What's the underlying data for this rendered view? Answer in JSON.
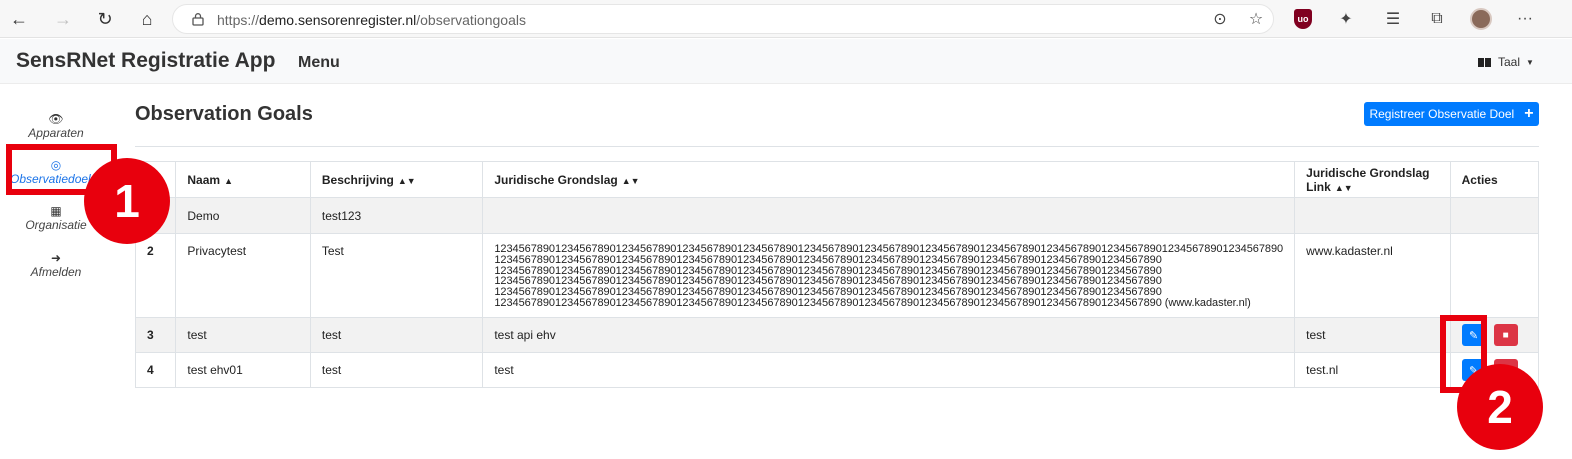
{
  "browser": {
    "url_prefix": "https://",
    "url_host": "demo.sensorenregister.nl",
    "url_path": "/observationgoals",
    "more": "···"
  },
  "navbar": {
    "brand": "SensRNet Registratie App",
    "menu": "Menu",
    "language": "Taal"
  },
  "sidebar": {
    "items": [
      {
        "label": "Apparaten",
        "icon": "eye-icon"
      },
      {
        "label": "Observatiedoelen",
        "icon": "target-icon"
      },
      {
        "label": "Organisatie",
        "icon": "building-icon"
      },
      {
        "label": "Afmelden",
        "icon": "sign-out-icon"
      }
    ]
  },
  "page": {
    "title": "Observation Goals",
    "register_button": "Registreer Observatie Doel"
  },
  "table": {
    "headers": [
      "Naam",
      "Beschrijving",
      "Juridische Grondslag",
      "Juridische Grondslag Link",
      "Acties"
    ],
    "rows": [
      {
        "id": "",
        "naam": "Demo",
        "beschrijving": "test123",
        "grondslag": "",
        "link": ""
      },
      {
        "id": "2",
        "naam": "Privacytest",
        "beschrijving": "Test",
        "grondslag": "1234567890123456789012345678901234567890123456789012345678901234567890123456789012345678901234567890123456789012345678901234567890\n12345678901234567890123456789012345678901234567890123456789012345678901234567890123456789012345678901234567890\n12345678901234567890123456789012345678901234567890123456789012345678901234567890123456789012345678901234567890\n12345678901234567890123456789012345678901234567890123456789012345678901234567890123456789012345678901234567890\n12345678901234567890123456789012345678901234567890123456789012345678901234567890123456789012345678901234567890\n12345678901234567890123456789012345678901234567890123456789012345678901234567890123456789012345678901234567890 (www.kadaster.nl)",
        "link": "www.kadaster.nl"
      },
      {
        "id": "3",
        "naam": "test",
        "beschrijving": "test",
        "grondslag": "test api ehv",
        "link": "test"
      },
      {
        "id": "4",
        "naam": "test ehv01",
        "beschrijving": "test",
        "grondslag": "test",
        "link": "test.nl"
      }
    ]
  },
  "annotations": {
    "marker_1": "1",
    "marker_2": "2",
    "color": "#e8000d"
  },
  "colors": {
    "primary": "#007bff",
    "danger": "#dc3545",
    "active_link": "#1a73e8"
  }
}
